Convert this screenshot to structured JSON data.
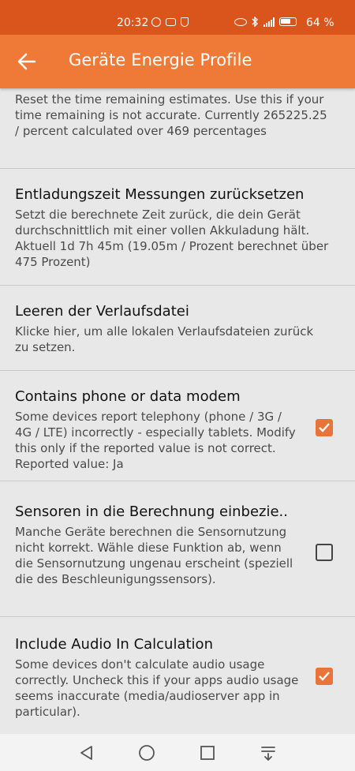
{
  "status_bar": {
    "time": "20:32",
    "battery_percent": "64 %",
    "icons": [
      "whatsapp-icon",
      "notification-icon",
      "shield-icon",
      "eye-icon",
      "bluetooth-icon",
      "lte-signal-icon",
      "battery-icon"
    ]
  },
  "app_bar": {
    "title": "Geräte Energie Profile",
    "back_icon": "arrow-left-icon"
  },
  "preferences": [
    {
      "title": "",
      "summary": "Reset the time remaining estimates. Use this if your time remaining is not accurate. Currently 265225.25 / percent calculated over 469 percentages"
    },
    {
      "title": "Entladungszeit Messungen zurücksetzen",
      "summary": "Setzt die berechnete Zeit zurück, die dein Gerät durchschnittlich mit einer vollen Akkuladung hält. Aktuell 1d 7h 45m (19.05m / Prozent berechnet über 475 Prozent)"
    },
    {
      "title": "Leeren der Verlaufsdatei",
      "summary": "Klicke hier, um alle lokalen Verlaufsdateien zurück zu setzen."
    },
    {
      "title": "Contains phone or data modem",
      "summary": "Some devices report telephony (phone / 3G / 4G / LTE) incorrectly - especially tablets. Modify this only if the reported value is not correct. Reported value: Ja",
      "checked": true
    },
    {
      "title": "Sensoren in die Berechnung einbezie..",
      "summary": "Manche Geräte berechnen die Sensornutzung nicht korrekt. Wähle diese Funktion ab, wenn die Sensornutzung ungenau erscheint (speziell die des Beschleunigungssensors).",
      "checked": false
    },
    {
      "title": "Include Audio In Calculation",
      "summary": "Some devices don't calculate audio usage correctly.  Uncheck this if your apps audio usage seems inaccurate (media/audioserver app in particular).",
      "checked": true
    }
  ],
  "nav_bar": {
    "icons": [
      "back-triangle-icon",
      "home-circle-icon",
      "recents-square-icon",
      "notification-pull-icon"
    ]
  },
  "colors": {
    "status_bar": "#d9551b",
    "app_bar": "#ef7a38",
    "checkbox_on": "#e8743a",
    "background": "#e8e8e8"
  }
}
